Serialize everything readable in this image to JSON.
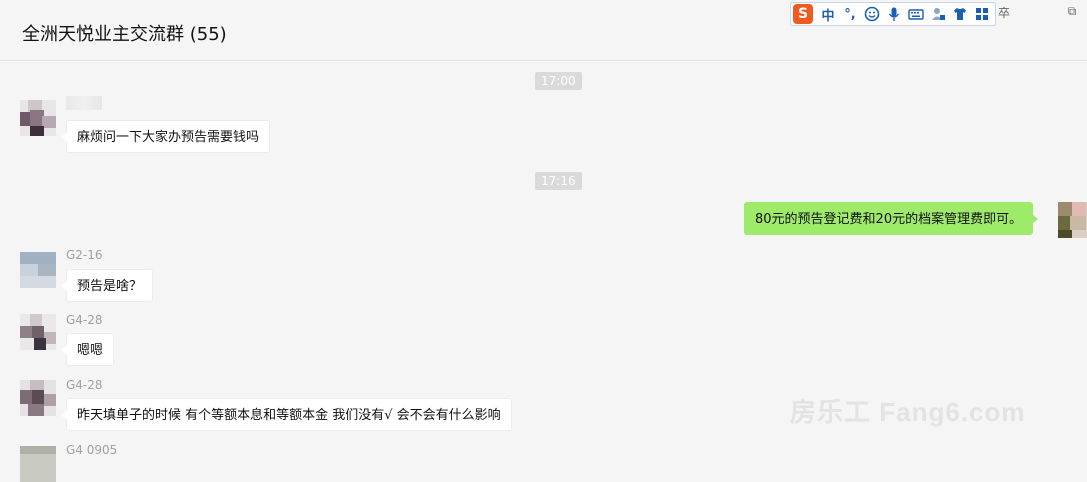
{
  "window": {
    "title": "全洲天悦业主交流群 (55)",
    "minimize_symbol": "卒",
    "restore_symbol": "⧉"
  },
  "ime": {
    "logo": "S",
    "mode": "中",
    "punct": "°,",
    "icons": [
      "emoji-icon",
      "mic-icon",
      "keyboard-icon",
      "user-icon",
      "shirt-icon",
      "grid-icon"
    ]
  },
  "messages": {
    "time1": "17:00",
    "m1": {
      "sender": "",
      "text": "麻烦问一下大家办预告需要钱吗"
    },
    "time2": "17:16",
    "m2": {
      "text": "80元的预告登记费和20元的档案管理费即可。"
    },
    "m3": {
      "sender": "G2-16",
      "text": "预告是啥？"
    },
    "m4": {
      "sender": "G4-28",
      "text": "嗯嗯"
    },
    "m5": {
      "sender": "G4-28",
      "text": "昨天填单子的时候 有个等额本息和等额本金 我们没有√ 会不会有什么影响"
    },
    "m6": {
      "sender": "G4 0905"
    }
  },
  "watermark": "房乐工 Fang6.com",
  "colors": {
    "background": "#f5f5f5",
    "my_bubble": "#9eea6a",
    "ime_accent": "#ef5b1e"
  }
}
